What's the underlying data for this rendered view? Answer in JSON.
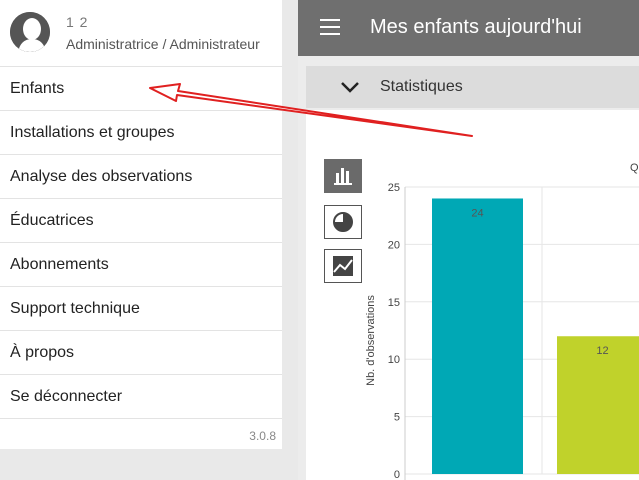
{
  "header": {
    "title": "Mes enfants aujourd'hui"
  },
  "stats": {
    "title": "Statistiques",
    "q_label": "Q"
  },
  "drawer": {
    "user_name": "1 2",
    "user_role": "Administratrice / Administrateur",
    "items": [
      {
        "label": "Enfants"
      },
      {
        "label": "Installations et groupes"
      },
      {
        "label": "Analyse des observations"
      },
      {
        "label": "Éducatrices"
      },
      {
        "label": "Abonnements"
      },
      {
        "label": "Support technique"
      },
      {
        "label": "À propos"
      },
      {
        "label": "Se déconnecter"
      }
    ],
    "version": "3.0.8"
  },
  "chart_data": {
    "type": "bar",
    "ylabel": "Nb. d'observations",
    "ylim": [
      0,
      25
    ],
    "yticks": [
      "0",
      "5",
      "10",
      "15",
      "20",
      "25"
    ],
    "categories": [
      "",
      ""
    ],
    "values": [
      24,
      12
    ],
    "data_labels": [
      "24",
      "12"
    ],
    "colors": [
      "#00a8b5",
      "#c0d22b"
    ],
    "grid": true
  },
  "colors": {
    "topbar": "#6f6f6f",
    "arrow": "#e02020"
  }
}
